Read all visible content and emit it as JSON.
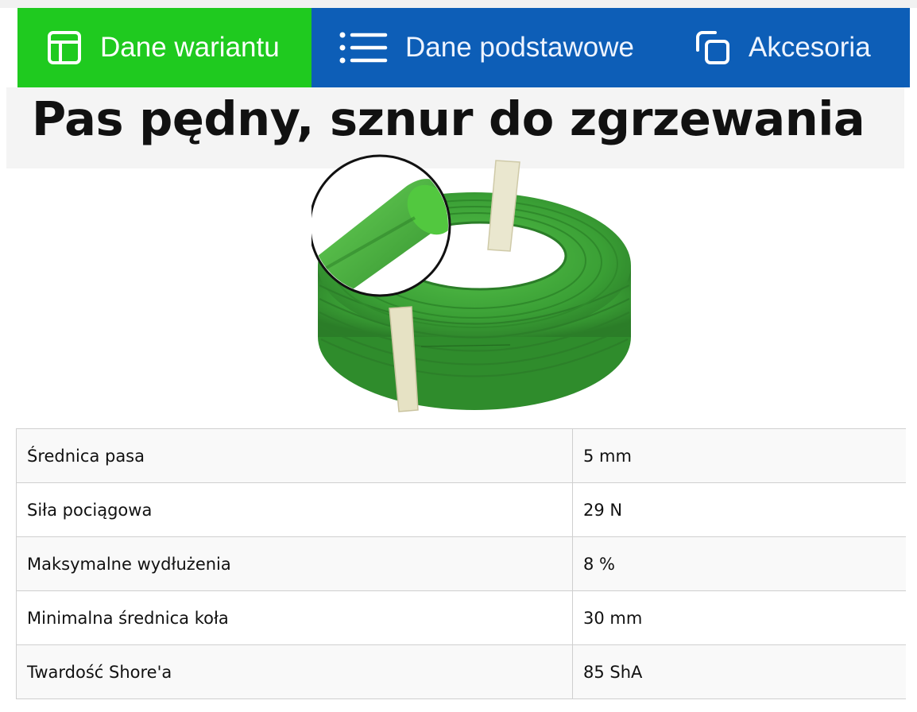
{
  "tabs": [
    {
      "label": "Dane wariantu",
      "icon": "layout-icon",
      "active": true,
      "color": "#1fca1f"
    },
    {
      "label": "Dane podstawowe",
      "icon": "list-icon",
      "active": false,
      "color": "#0d5eb7"
    },
    {
      "label": "Akcesoria",
      "icon": "copy-icon",
      "active": false,
      "color": "#0d5eb7"
    }
  ],
  "product": {
    "title": "Pas pędny, sznur do zgrzewania",
    "image_alt_icon": "green-belt-coil-image",
    "accent_green": "#3aa53a"
  },
  "specs": [
    {
      "label": "Średnica pasa",
      "value": "5 mm"
    },
    {
      "label": "Siła pociągowa",
      "value": "29 N"
    },
    {
      "label": "Maksymalne wydłużenia",
      "value": "8 %"
    },
    {
      "label": "Minimalna średnica koła",
      "value": "30 mm"
    },
    {
      "label": "Twardość Shore'a",
      "value": "85 ShA"
    }
  ]
}
